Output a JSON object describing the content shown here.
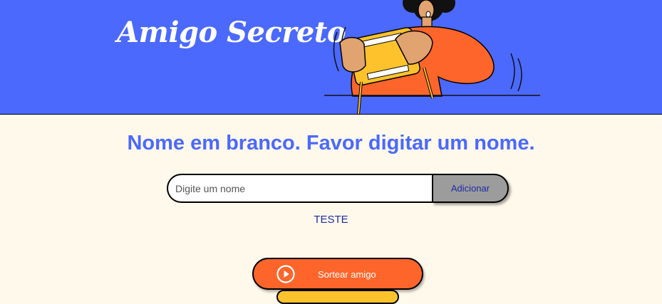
{
  "header": {
    "title": "Amigo Secreto"
  },
  "main": {
    "status_message": "Nome em branco. Favor digitar um nome.",
    "input": {
      "placeholder": "Digite um nome",
      "value": ""
    },
    "add_button_label": "Adicionar",
    "friends": [
      "TESTE"
    ],
    "draw_button_label": "Sortear amigo",
    "draw_button_icon": "play-circle-icon"
  },
  "colors": {
    "header_bg": "#4B69FD",
    "page_bg": "#FFF9EB",
    "accent_orange": "#FE652B",
    "accent_yellow": "#FEC32C",
    "text_blue": "#1D2DA5"
  }
}
